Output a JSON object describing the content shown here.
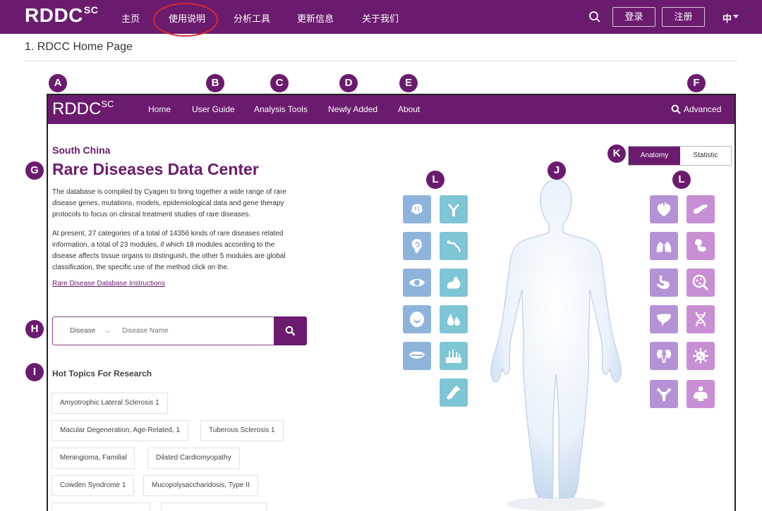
{
  "outer_nav": {
    "logo": "RDDC",
    "logo_sup": "SC",
    "items": [
      "主页",
      "使用说明",
      "分析工具",
      "更新信息",
      "关于我们"
    ],
    "login": "登录",
    "register": "注册",
    "lang": "中"
  },
  "section_title": "1. RDCC Home Page",
  "markers": [
    "A",
    "B",
    "C",
    "D",
    "E",
    "F",
    "G",
    "H",
    "I",
    "J",
    "K",
    "L",
    "L"
  ],
  "inner_nav": {
    "logo": "RDDC",
    "logo_sup": "SC",
    "items": [
      "Home",
      "User Guide",
      "Analysis Tools",
      "Newly Added",
      "About"
    ],
    "advanced": "Advanced"
  },
  "hero": {
    "subtitle": "South China",
    "title": "Rare Diseases Data Center",
    "para1": "The database is compiled by Cyagen to bring together a wide range of rare disease genes, mutations, models, epidemiological data and gene therapy protocols to focus on clinical treatment studies of rare diseases.",
    "para2": "At present, 27 categories of a total of 14356 kinds of rare diseases related information, a total of 23 modules, if which 18 modules according to the disease affects tissue organs to distinguish, the other 5 modules are global classification, the specific use of the method click on the.",
    "link": "Rare Disease Database Instructions"
  },
  "search": {
    "select": "Disease",
    "placeholder": "Disease Name"
  },
  "hot": {
    "title": "Hot Topics For Research",
    "tags": [
      "Amyotrophic Lateral Sclerosis 1",
      "Macular Degeneration, Age-Related, 1",
      "Tuberous Sclerosis 1",
      "Meningioma, Familial",
      "Dilated Cardiomyopathy",
      "Cowden Syndrome 1",
      "Mucopolysaccharidosis, Type II"
    ]
  },
  "tabs": [
    "Anatomy",
    "Statistic"
  ],
  "organs_left": [
    "brain-icon",
    "immune-icon",
    "ear-icon",
    "nerve-icon",
    "eye-icon",
    "muscle-icon",
    "mouth-icon",
    "fluid-icon",
    "lips-icon",
    "skin-icon",
    "bone-icon"
  ],
  "organs_right": [
    "heart-icon",
    "pancreas-icon",
    "lungs-icon",
    "fetus-icon",
    "stomach-icon",
    "cell-icon",
    "liver-icon",
    "dna-icon",
    "kidney-icon",
    "virus-icon",
    "uterus-icon",
    "obesity-icon"
  ],
  "colors": {
    "brand": "#6b1b6e",
    "annotation_circle": "#d92b2b"
  }
}
